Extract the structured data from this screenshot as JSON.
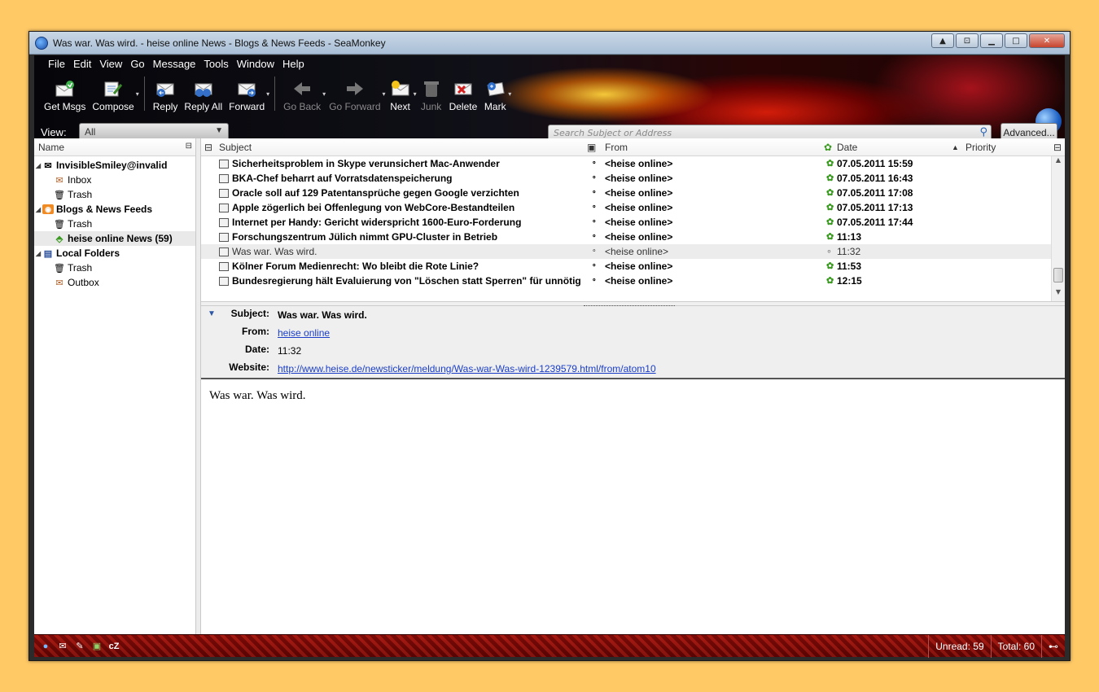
{
  "window": {
    "title": "Was war. Was wird. - heise online News - Blogs & News Feeds - SeaMonkey"
  },
  "menu": [
    "File",
    "Edit",
    "View",
    "Go",
    "Message",
    "Tools",
    "Window",
    "Help"
  ],
  "toolbar": {
    "get_msgs": "Get Msgs",
    "compose": "Compose",
    "reply": "Reply",
    "reply_all": "Reply All",
    "forward": "Forward",
    "go_back": "Go Back",
    "go_forward": "Go Forward",
    "next": "Next",
    "junk": "Junk",
    "delete": "Delete",
    "mark": "Mark"
  },
  "viewbar": {
    "label": "View:",
    "selected": "All",
    "search_placeholder": "Search Subject or Address",
    "advanced": "Advanced..."
  },
  "folders": {
    "header": "Name",
    "items": [
      {
        "label": "InvisibleSmiley@invalid"
      },
      {
        "label": "Inbox"
      },
      {
        "label": "Trash"
      },
      {
        "label": "Blogs & News Feeds"
      },
      {
        "label": "Trash"
      },
      {
        "label": "heise online News (59)"
      },
      {
        "label": "Local Folders"
      },
      {
        "label": "Trash"
      },
      {
        "label": "Outbox"
      }
    ]
  },
  "thread": {
    "headers": {
      "subject": "Subject",
      "from": "From",
      "date": "Date",
      "priority": "Priority"
    },
    "rows": [
      {
        "subject": "Sicherheitsproblem in Skype verunsichert Mac-Anwender",
        "from": "<heise online>",
        "date": "07.05.2011 15:59"
      },
      {
        "subject": "BKA-Chef beharrt auf Vorratsdatenspeicherung",
        "from": "<heise online>",
        "date": "07.05.2011 16:43"
      },
      {
        "subject": "Oracle soll auf 129 Patentansprüche gegen Google verzichten",
        "from": "<heise online>",
        "date": "07.05.2011 17:08"
      },
      {
        "subject": "Apple zögerlich bei Offenlegung von WebCore-Bestandteilen",
        "from": "<heise online>",
        "date": "07.05.2011 17:13"
      },
      {
        "subject": "Internet per Handy: Gericht widerspricht 1600-Euro-Forderung",
        "from": "<heise online>",
        "date": "07.05.2011 17:44"
      },
      {
        "subject": "Forschungszentrum Jülich nimmt GPU-Cluster in Betrieb",
        "from": "<heise online>",
        "date": "11:13"
      },
      {
        "subject": "Was war. Was wird.",
        "from": "<heise online>",
        "date": "11:32"
      },
      {
        "subject": "Kölner Forum Medienrecht: Wo bleibt die Rote Linie?",
        "from": "<heise online>",
        "date": "11:53"
      },
      {
        "subject": "Bundesregierung hält Evaluierung von \"Löschen statt Sperren\" für unnötig",
        "from": "<heise online>",
        "date": "12:15"
      }
    ]
  },
  "message": {
    "subject_label": "Subject:",
    "subject": "Was war. Was wird.",
    "from_label": "From:",
    "from": "heise online",
    "date_label": "Date:",
    "date": "11:32",
    "website_label": "Website:",
    "website": "http://www.heise.de/newsticker/meldung/Was-war-Was-wird-1239579.html/from/atom10",
    "body": "Was war. Was wird."
  },
  "status": {
    "unread": "Unread: 59",
    "total": "Total: 60"
  }
}
